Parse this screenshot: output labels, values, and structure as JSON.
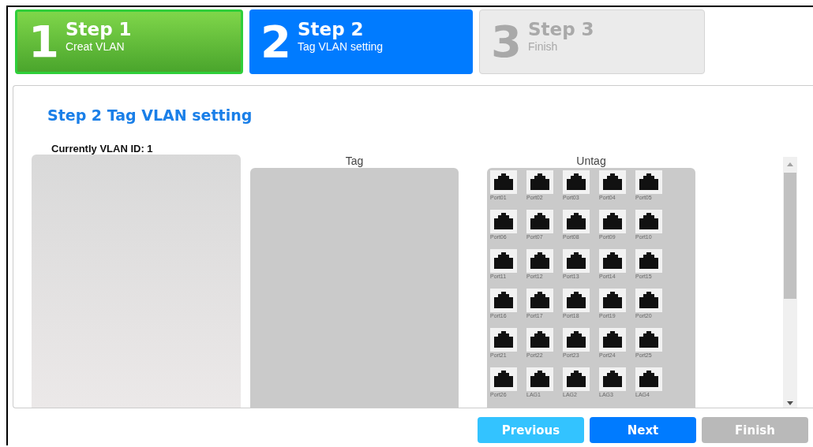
{
  "steps": [
    {
      "number": "1",
      "title": "Step 1",
      "subtitle": "Creat VLAN",
      "kind": "done"
    },
    {
      "number": "2",
      "title": "Step 2",
      "subtitle": "Tag VLAN setting",
      "kind": "current"
    },
    {
      "number": "3",
      "title": "Step 3",
      "subtitle": "Finish",
      "kind": "pending"
    }
  ],
  "panel": {
    "heading": "Step 2 Tag VLAN setting",
    "vlan_label": "Currently VLAN ID: 1",
    "tag": {
      "label": "Tag"
    },
    "untag": {
      "label": "Untag",
      "ports": [
        "Port01",
        "Port02",
        "Port03",
        "Port04",
        "Port05",
        "Port06",
        "Port07",
        "Port08",
        "Port09",
        "Port10",
        "Port11",
        "Port12",
        "Port13",
        "Port14",
        "Port15",
        "Port16",
        "Port17",
        "Port18",
        "Port19",
        "Port20",
        "Port21",
        "Port22",
        "Port23",
        "Port24",
        "Port25",
        "Port26",
        "LAG1",
        "LAG2",
        "LAG3",
        "LAG4"
      ]
    }
  },
  "buttons": [
    {
      "label": "Previous",
      "kind": "secondary",
      "disabled": false
    },
    {
      "label": "Next",
      "kind": "primary",
      "disabled": false
    },
    {
      "label": "Finish",
      "kind": "primary",
      "disabled": true
    }
  ]
}
